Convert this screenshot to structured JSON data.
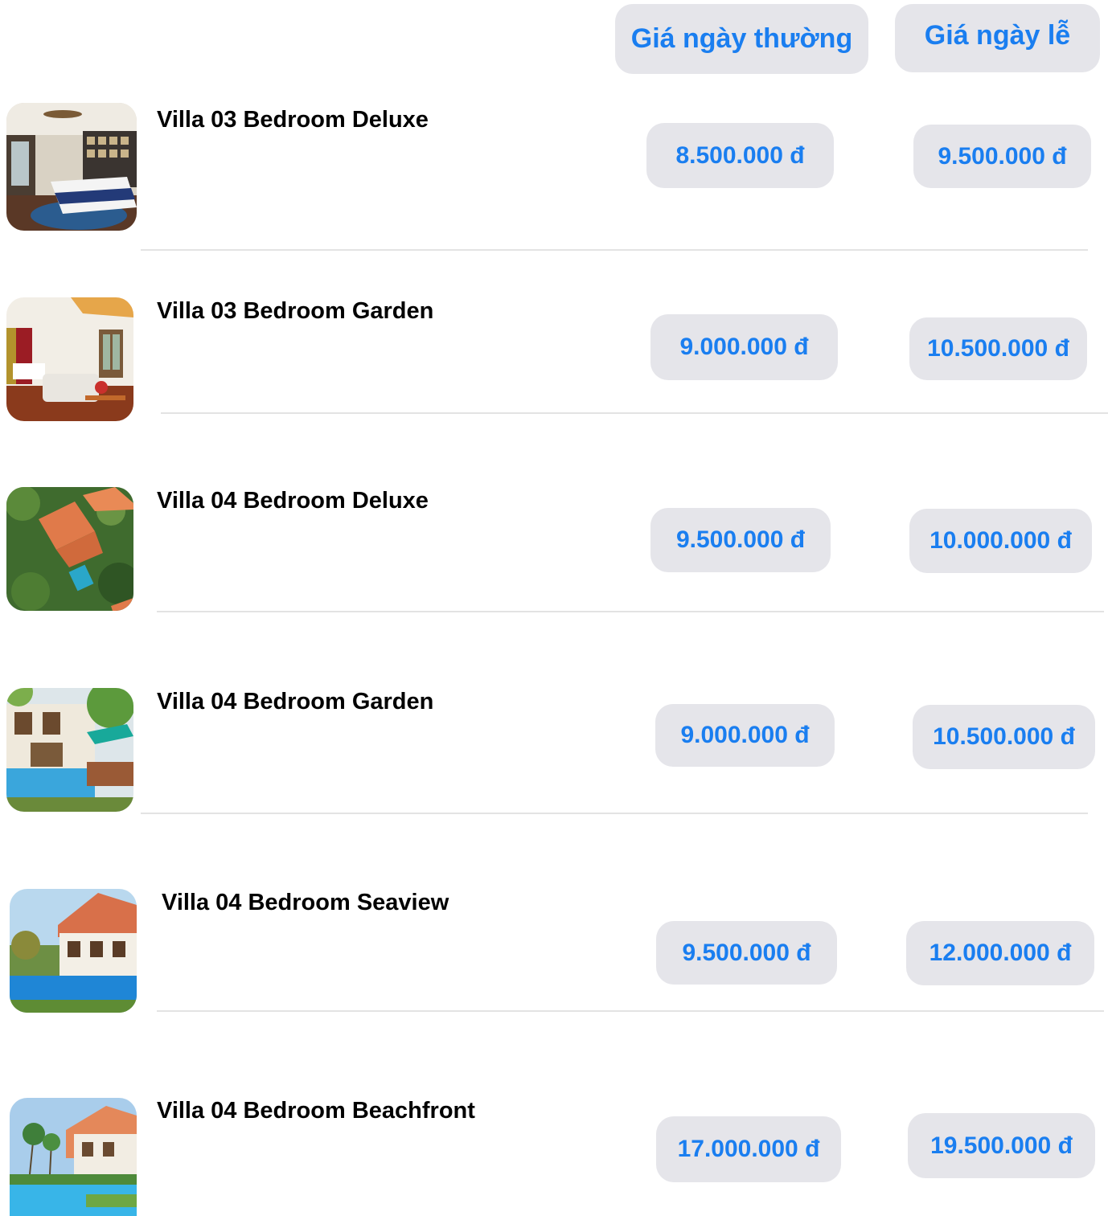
{
  "header": {
    "weekday_label": "Giá ngày thường",
    "holiday_label": "Giá ngày lễ"
  },
  "colors": {
    "accent": "#1a7ef0",
    "pill_bg": "#e5e5ea"
  },
  "rows": [
    {
      "name": "Villa 03 Bedroom Deluxe",
      "weekday_price": "8.500.000 đ",
      "holiday_price": "9.500.000 đ",
      "photo": "bedroom-interior"
    },
    {
      "name": "Villa 03 Bedroom Garden",
      "weekday_price": "9.000.000 đ",
      "holiday_price": "10.500.000 đ",
      "photo": "bedroom-living"
    },
    {
      "name": "Villa 04 Bedroom Deluxe",
      "weekday_price": "9.500.000 đ",
      "holiday_price": "10.000.000 đ",
      "photo": "aerial-villa"
    },
    {
      "name": "Villa 04 Bedroom Garden",
      "weekday_price": "9.000.000 đ",
      "holiday_price": "10.500.000 đ",
      "photo": "garden-pool"
    },
    {
      "name": "Villa 04 Bedroom Seaview",
      "weekday_price": "9.500.000 đ",
      "holiday_price": "12.000.000 đ",
      "photo": "seaview-pool"
    },
    {
      "name": "Villa 04 Bedroom Beachfront",
      "weekday_price": "17.000.000 đ",
      "holiday_price": "19.500.000 đ",
      "photo": "beachfront-pool"
    }
  ]
}
